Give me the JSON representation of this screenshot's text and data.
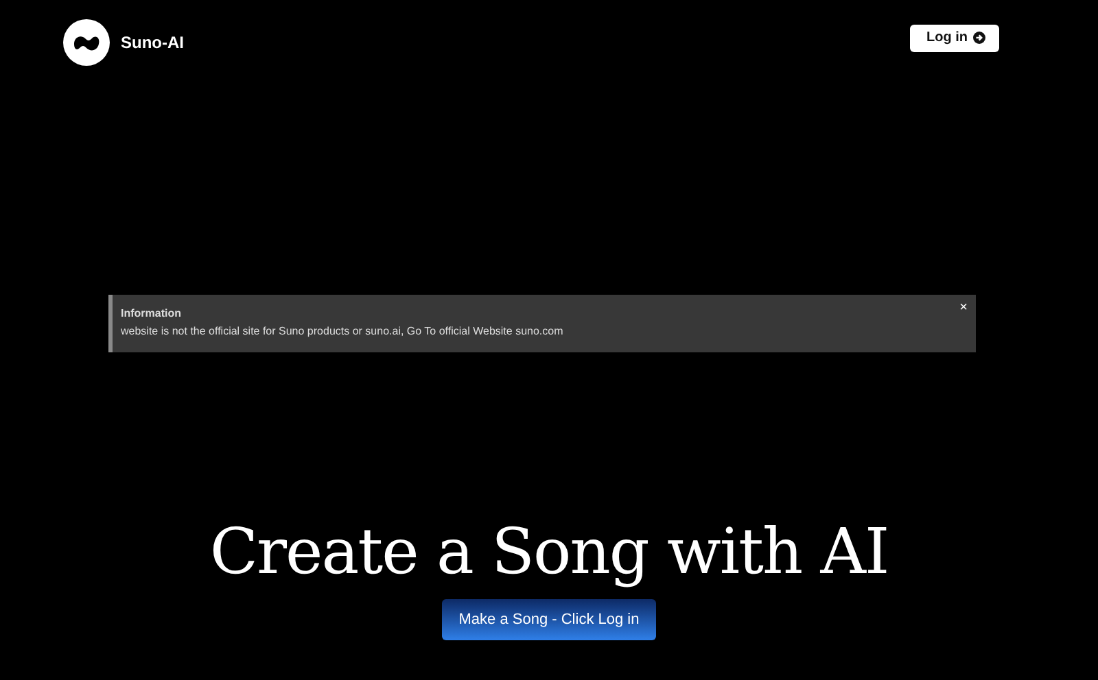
{
  "header": {
    "brand": "Suno-AI",
    "login_button": "Log in"
  },
  "alert": {
    "title": "Information",
    "message": "website is not the official site for Suno products or suno.ai, Go To official Website suno.com",
    "close": "×"
  },
  "hero": {
    "heading": "Create a Song with AI",
    "cta_button": "Make a Song - Click Log in"
  }
}
